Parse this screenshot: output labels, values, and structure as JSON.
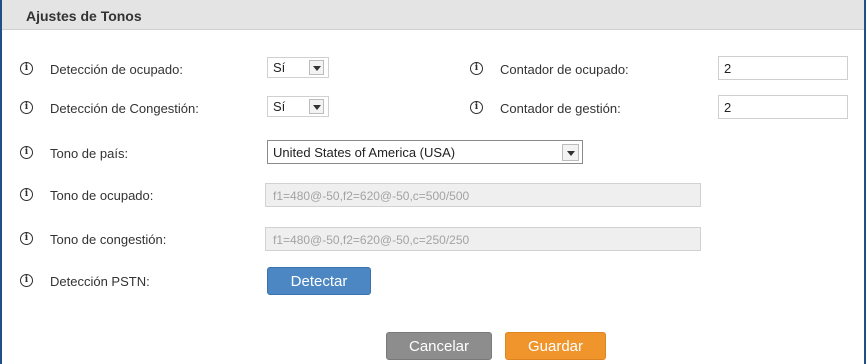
{
  "header": {
    "title": "Ajustes de Tonos"
  },
  "fields": {
    "busy_detection": {
      "label": "Detección de ocupado:",
      "value": "Sí"
    },
    "busy_counter": {
      "label": "Contador de ocupado:",
      "value": "2"
    },
    "congestion_detection": {
      "label": "Detección de Congestión:",
      "value": "Sí"
    },
    "congestion_counter": {
      "label": "Contador de gestión:",
      "value": "2"
    },
    "country_tone": {
      "label": "Tono de país:",
      "value": "United States of America (USA)"
    },
    "busy_tone": {
      "label": "Tono de ocupado:",
      "value": "f1=480@-50,f2=620@-50,c=500/500"
    },
    "congestion_tone": {
      "label": "Tono de congestión:",
      "value": "f1=480@-50,f2=620@-50,c=250/250"
    },
    "pstn_detection": {
      "label": "Detección PSTN:",
      "button": "Detectar"
    }
  },
  "actions": {
    "cancel": "Cancelar",
    "save": "Guardar"
  },
  "colors": {
    "border": "#1f4f86",
    "header_bg": "#e4e4e4",
    "detect_button": "#4c87c4",
    "cancel_button": "#8d8d8d",
    "save_button": "#f0952c"
  },
  "icons": {
    "info": "info-circle-icon"
  }
}
